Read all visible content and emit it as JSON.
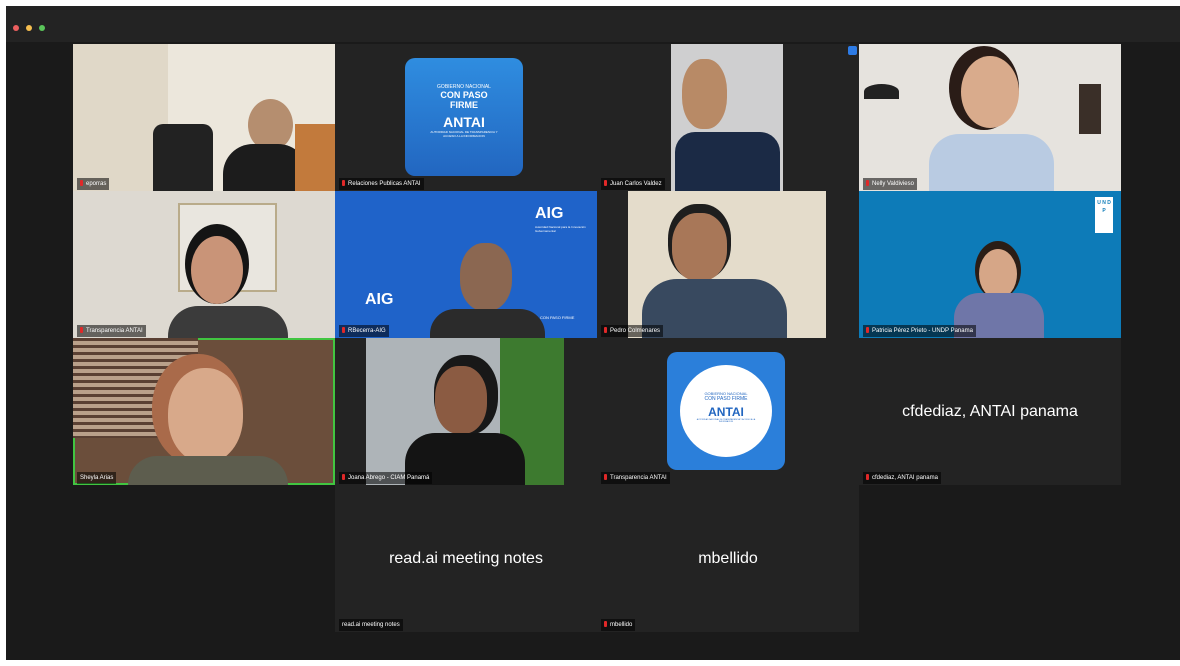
{
  "window": {
    "lights": [
      "#ec5f5f",
      "#f6be4f",
      "#5ac55a"
    ]
  },
  "tiles": [
    {
      "name": "eporras"
    },
    {
      "name": "Relaciones Publicas ANTAI",
      "logo": {
        "line1": "GOBIERNO NACIONAL",
        "line2": "CON PASO",
        "line3": "FIRME",
        "brand": "ANTAI",
        "sub": "AUTORIDAD NACIONAL DE TRANSPARENCIA Y ACCESO A LA INFORMACION"
      }
    },
    {
      "name": "Juan Carlos Valdez"
    },
    {
      "name": "Nelly Valdivieso"
    },
    {
      "name": "Transparencia ANTAI"
    },
    {
      "name": "RBecerra-AIG",
      "brand": "AIG",
      "sub": "Autoridad Nacional para la Innovación Gubernamental",
      "footer": "CON PASO FIRME"
    },
    {
      "name": "Pedro Colmenares"
    },
    {
      "name": "Patricia Pérez Prieto - UNDP Panama",
      "undp": "U N D P"
    },
    {
      "name": "Sheyla Arias"
    },
    {
      "name": "Joana Abrego - CIAM Panamá"
    },
    {
      "name": "Transparencia ANTAI",
      "logo": {
        "line1": "GOBIERNO NACIONAL",
        "line2": "CON PASO FIRME",
        "brand": "ANTAI",
        "sub": "AUTORIDAD NACIONAL DE TRANSPARENCIA Y ACCESO A LA INFORMACION"
      }
    },
    {
      "name": "cfdediaz, ANTAI panama",
      "display": "cfdediaz, ANTAI panama"
    },
    {
      "name": "read.ai meeting notes",
      "display": "read.ai meeting notes"
    },
    {
      "name": "mbellido",
      "display": "mbellido"
    }
  ]
}
